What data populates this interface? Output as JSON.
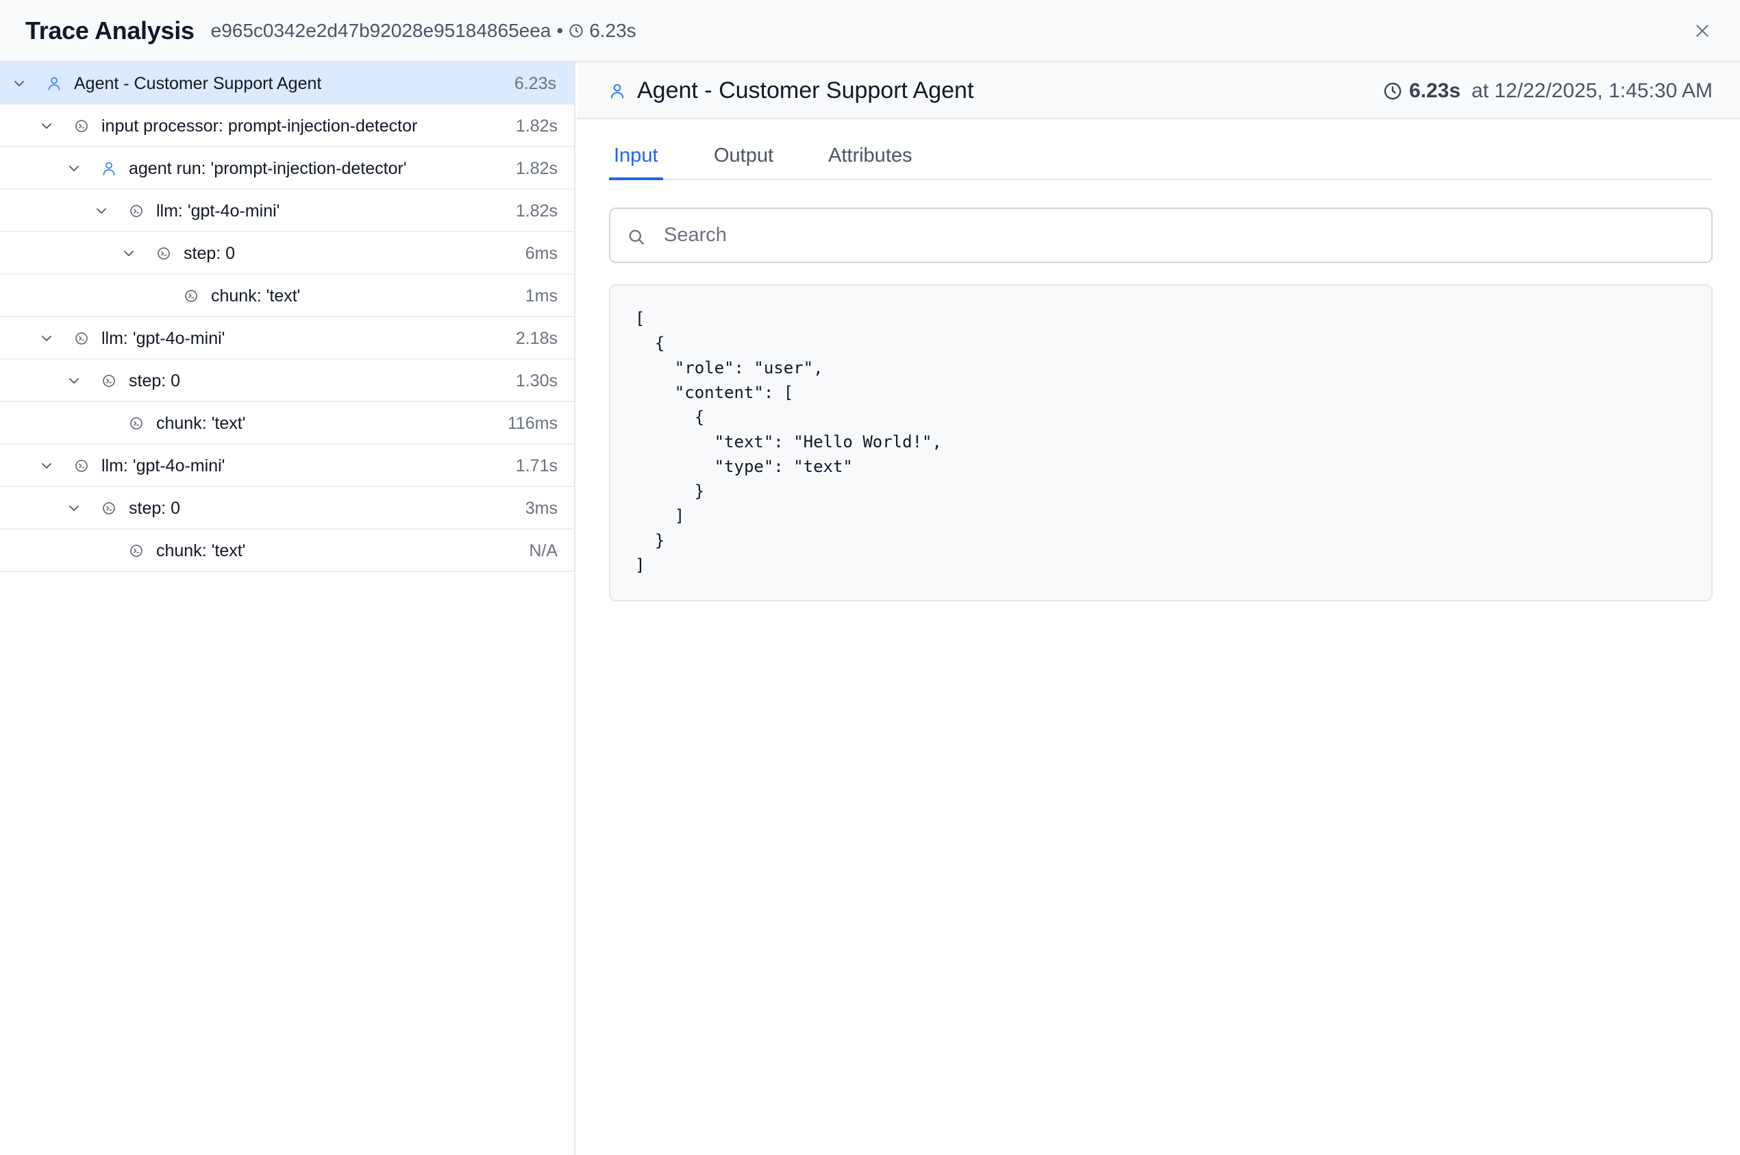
{
  "header": {
    "title": "Trace Analysis",
    "trace_id": "e965c0342e2d47b92028e95184865eea",
    "separator": "•",
    "duration": "6.23s"
  },
  "tree": [
    {
      "label": "Agent - Customer Support Agent",
      "duration": "6.23s",
      "icon": "user-icon",
      "expanded": true,
      "selected": true
    },
    {
      "label": "input processor: prompt-injection-detector",
      "duration": "1.82s",
      "icon": "span-icon",
      "expanded": true
    },
    {
      "label": "agent run: 'prompt-injection-detector'",
      "duration": "1.82s",
      "icon": "user-icon",
      "expanded": true
    },
    {
      "label": "llm: 'gpt-4o-mini'",
      "duration": "1.82s",
      "icon": "span-icon",
      "expanded": true
    },
    {
      "label": "step: 0",
      "duration": "6ms",
      "icon": "span-icon",
      "expanded": true
    },
    {
      "label": "chunk: 'text'",
      "duration": "1ms",
      "icon": "span-icon"
    },
    {
      "label": "llm: 'gpt-4o-mini'",
      "duration": "2.18s",
      "icon": "span-icon",
      "expanded": true
    },
    {
      "label": "step: 0",
      "duration": "1.30s",
      "icon": "span-icon",
      "expanded": true
    },
    {
      "label": "chunk: 'text'",
      "duration": "116ms",
      "icon": "span-icon"
    },
    {
      "label": "llm: 'gpt-4o-mini'",
      "duration": "1.71s",
      "icon": "span-icon",
      "expanded": true
    },
    {
      "label": "step: 0",
      "duration": "3ms",
      "icon": "span-icon",
      "expanded": true
    },
    {
      "label": "chunk: 'text'",
      "duration": "N/A",
      "icon": "span-icon"
    }
  ],
  "detail": {
    "name": "Agent - Customer Support Agent",
    "duration": "6.23s",
    "timestamp": "at 12/22/2025, 1:45:30 AM",
    "tabs": [
      "Input",
      "Output",
      "Attributes"
    ],
    "active_tab": "Input",
    "search_placeholder": "Search",
    "search_value": "",
    "input_json": "[\n  {\n    \"role\": \"user\",\n    \"content\": [\n      {\n        \"text\": \"Hello World!\",\n        \"type\": \"text\"\n      }\n    ]\n  }\n]"
  },
  "colors": {
    "accent": "#2563eb",
    "selected_row": "#dbeafe",
    "header_bg": "#f8fafc",
    "user_icon": "#3b82f6",
    "span_icon": "#6b7280"
  }
}
